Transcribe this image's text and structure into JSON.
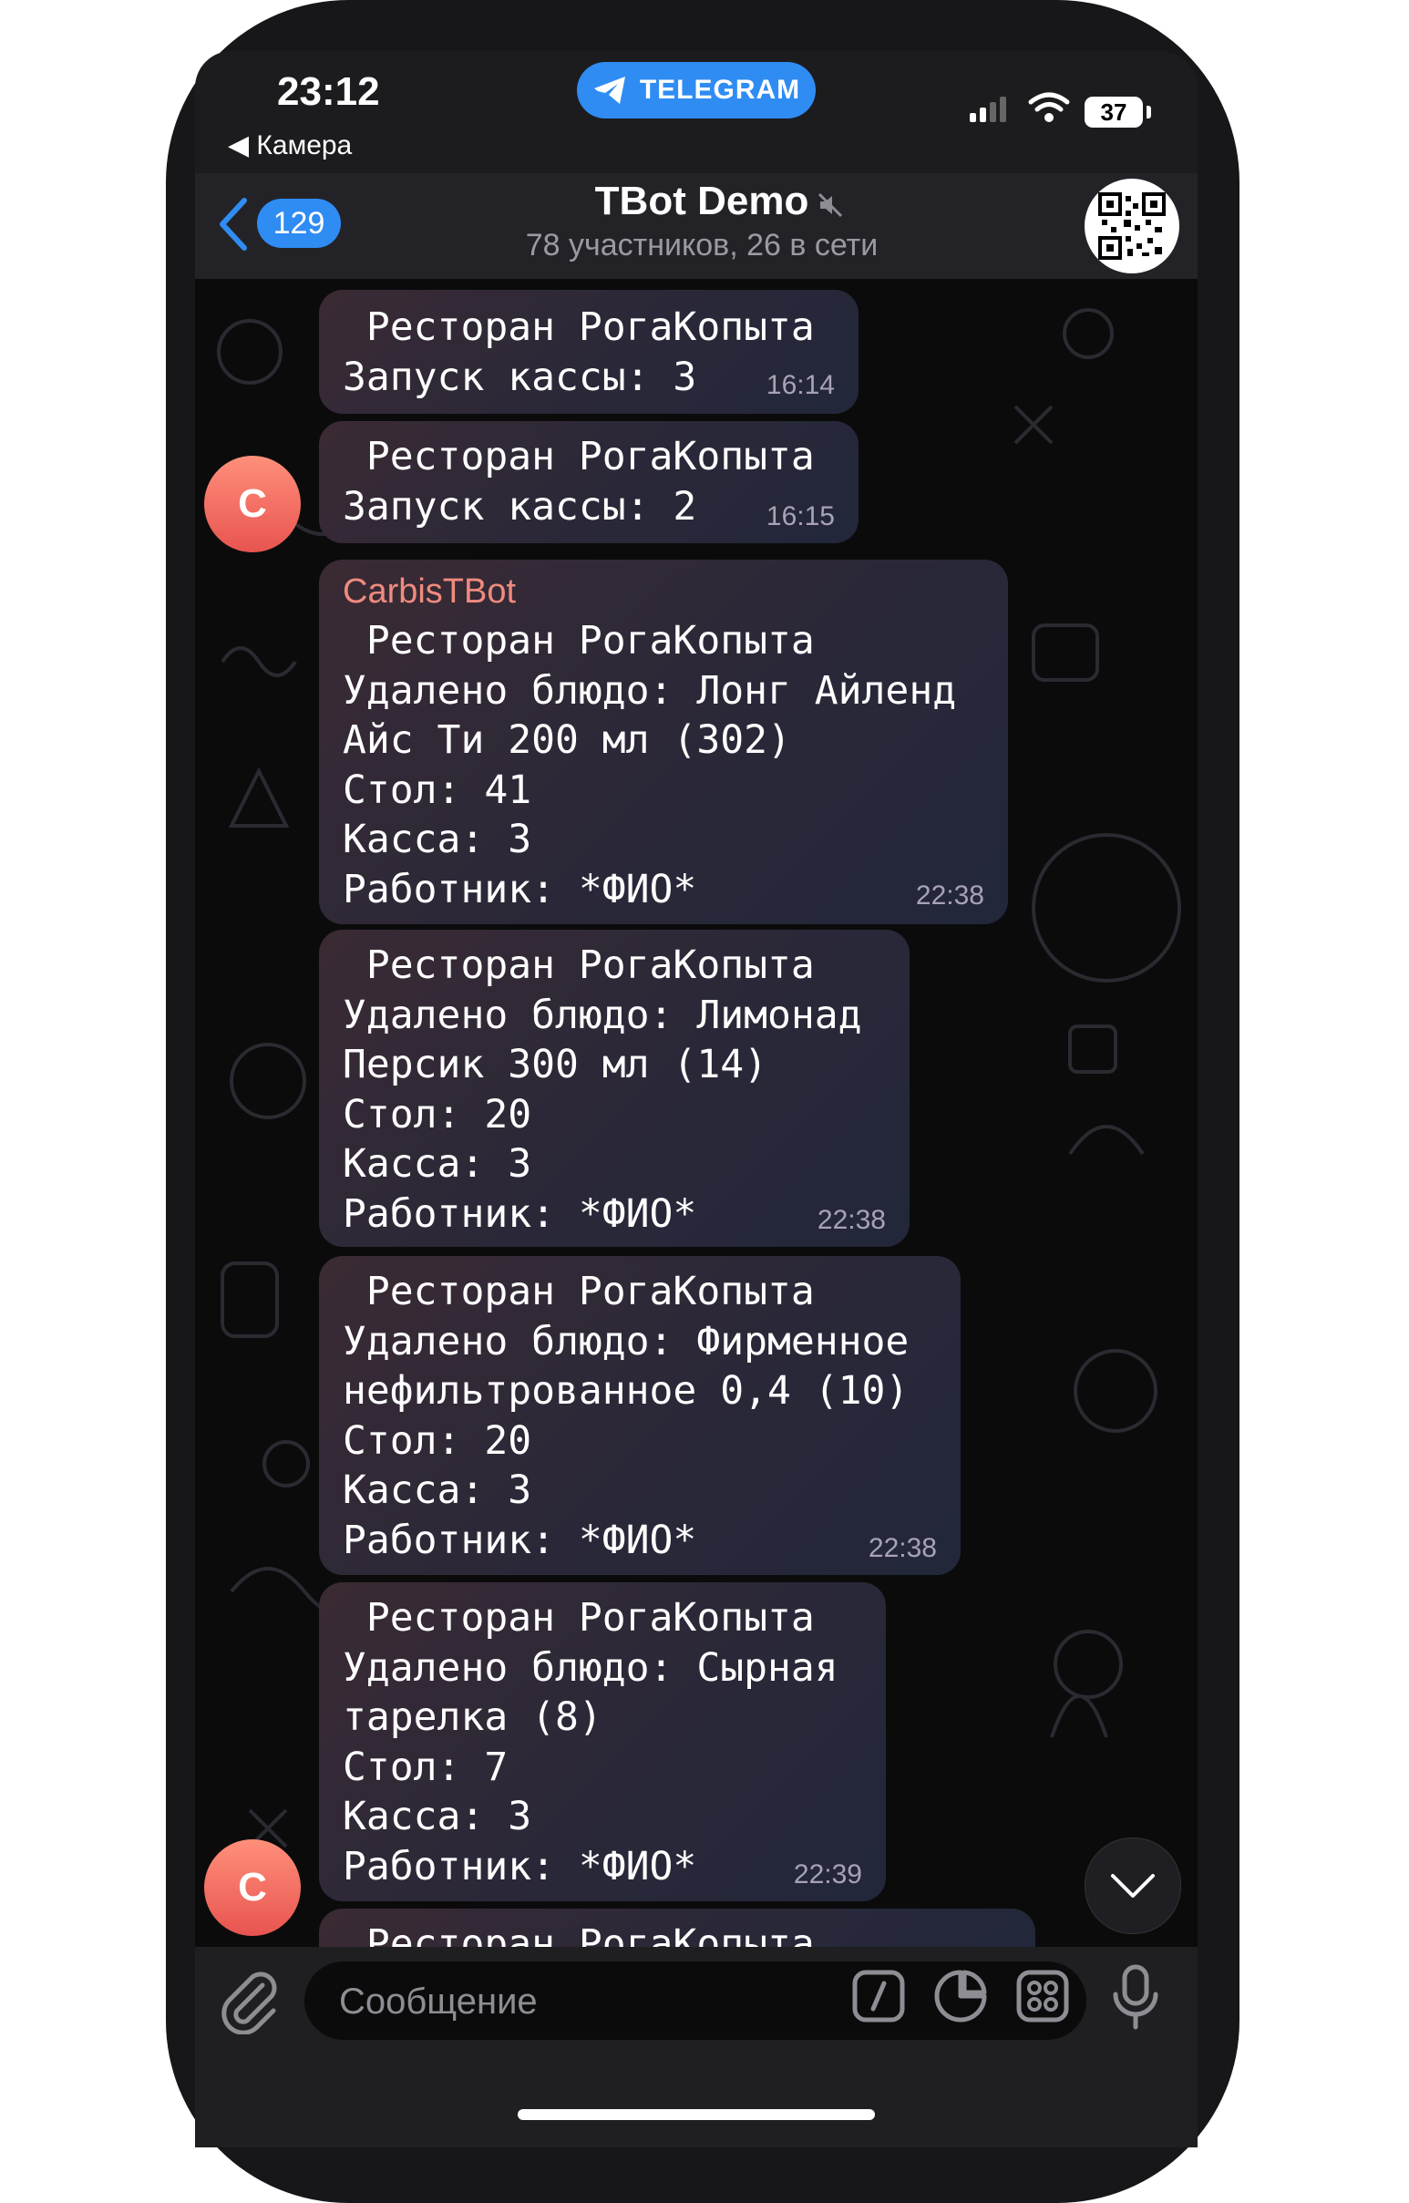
{
  "status_bar": {
    "time": "23:12",
    "back_app": "◀ Камера",
    "pill_label": "TELEGRAM",
    "battery": "37"
  },
  "header": {
    "back_count": "129",
    "title": "TBot Demo",
    "subtitle": "78 участников, 26 в сети"
  },
  "avatar_letter": "C",
  "messages": [
    {
      "sender": "",
      "lines": " Ресторан РогаКопыта\nЗапуск кассы: 3",
      "time": "16:14"
    },
    {
      "sender": "",
      "lines": " Ресторан РогаКопыта\nЗапуск кассы: 2",
      "time": "16:15"
    },
    {
      "sender": "CarbisTBot",
      "lines": " Ресторан РогаКопыта\nУдалено блюдо: Лонг Айленд\nАйс Ти 200 мл (302)\nСтол: 41\nКасса: 3\nРаботник: *ФИО*",
      "time": "22:38"
    },
    {
      "sender": "",
      "lines": " Ресторан РогаКопыта\nУдалено блюдо: Лимонад\nПерсик 300 мл (14)\nСтол: 20\nКасса: 3\nРаботник: *ФИО*",
      "time": "22:38"
    },
    {
      "sender": "",
      "lines": " Ресторан РогаКопыта\nУдалено блюдо: Фирменное\nнефильтрованное 0,4 (10)\nСтол: 20\nКасса: 3\nРаботник: *ФИО*",
      "time": "22:38"
    },
    {
      "sender": "",
      "lines": " Ресторан РогаКопыта\nУдалено блюдо: Сырная\nтарелка (8)\nСтол: 7\nКасса: 3\nРаботник: *ФИО*",
      "time": "22:39"
    },
    {
      "sender": "",
      "lines": " Ресторан РогаКопыта",
      "time": ""
    }
  ],
  "input": {
    "placeholder": "Сообщение"
  },
  "icons": [
    "telegram-plane-icon",
    "signal-icon",
    "wifi-icon",
    "battery-icon",
    "back-chevron-icon",
    "mute-icon",
    "qr-code-icon",
    "chevron-down-icon",
    "paperclip-icon",
    "command-icon",
    "sticker-icon",
    "emoji-grid-icon",
    "microphone-icon"
  ],
  "colors": {
    "accent": "#2f8cf3",
    "sender_name": "#f08b7f",
    "avatar": "#e85450"
  }
}
